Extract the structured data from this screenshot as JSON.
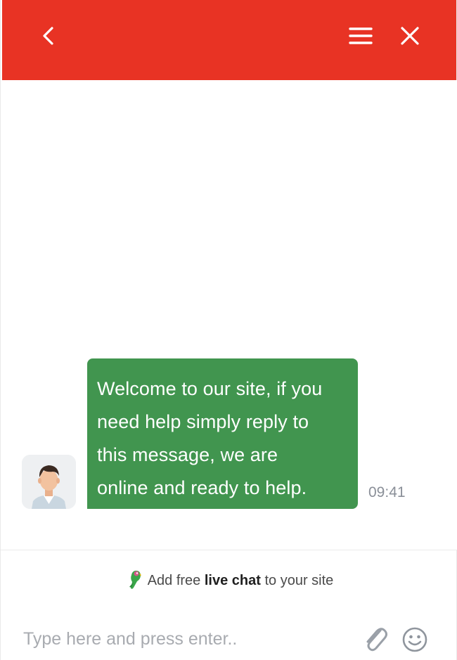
{
  "header": {
    "background_color": "#e83324",
    "back_icon": "chevron-left-icon",
    "menu_icon": "hamburger-menu-icon",
    "close_icon": "close-icon"
  },
  "conversation": {
    "messages": [
      {
        "sender": "agent",
        "avatar_icon": "agent-avatar",
        "lines": [
          "Welcome to our site, if you",
          "need help simply reply to",
          "this message, we are",
          "online and ready to help."
        ],
        "time": "09:41",
        "bubble_color": "#41954f"
      }
    ]
  },
  "footer": {
    "promo": {
      "prefix": "Add free ",
      "bold": "live chat",
      "suffix": " to your site",
      "logo_icon": "parrot-logo-icon"
    },
    "input": {
      "placeholder": "Type here and press enter..",
      "value": ""
    },
    "attach_icon": "paperclip-icon",
    "emoji_icon": "smiley-icon"
  }
}
